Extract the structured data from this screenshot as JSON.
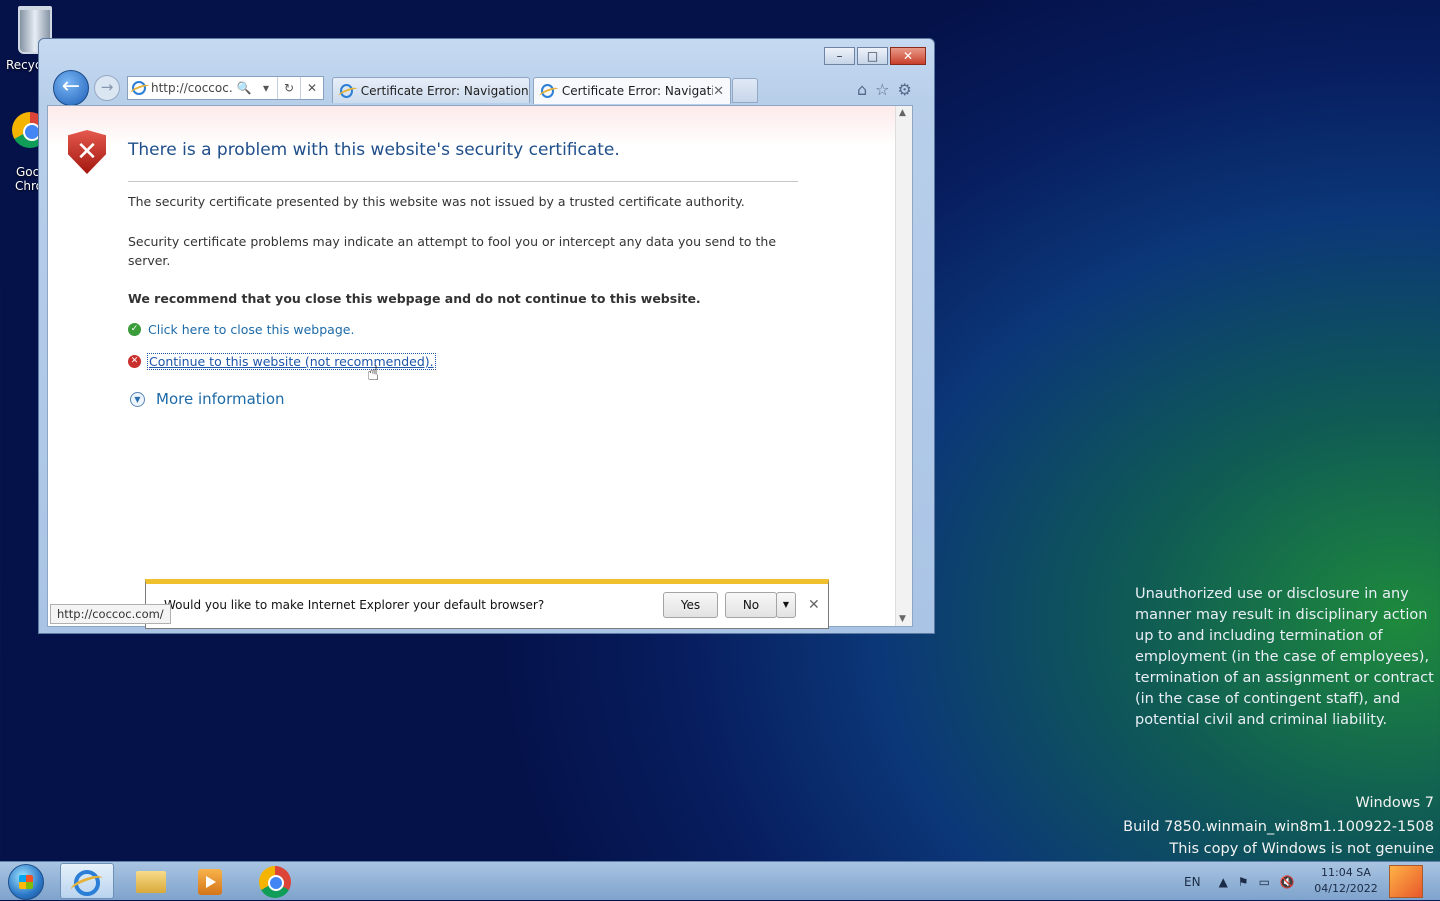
{
  "desktop": {
    "recycle_bin_label": "Recyc",
    "chrome_label_line1": "Goc",
    "chrome_label_line2": "Chro"
  },
  "window": {
    "caption_buttons": {
      "minimize": "–",
      "maximize": "□",
      "close": "✕"
    },
    "address_bar": {
      "url": "http://coccoc....",
      "search_icon": "🔍",
      "dropdown": "▾",
      "refresh": "↻",
      "stop": "✕"
    },
    "tabs": [
      {
        "title": "Certificate Error: Navigation B...",
        "active": false
      },
      {
        "title": "Certificate Error: Navigatio...",
        "active": true,
        "close": "✕"
      }
    ],
    "command_icons": {
      "home": "⌂",
      "favorites": "☆",
      "tools": "⚙"
    }
  },
  "cert_error": {
    "title": "There is a problem with this website's security certificate.",
    "paragraph1": "The security certificate presented by this website was not issued by a trusted certificate authority.",
    "paragraph2": "Security certificate problems may indicate an attempt to fool you or intercept any data you send to the server.",
    "recommendation": "We recommend that you close this webpage and do not continue to this website.",
    "close_link": "Click here to close this webpage.",
    "continue_link": "Continue to this website (not recommended).",
    "more_info": "More information"
  },
  "notification": {
    "message": "Would you like to make Internet Explorer your default browser?",
    "yes": "Yes",
    "no": "No",
    "dropdown": "▼",
    "close": "✕"
  },
  "status_url": "http://coccoc.com/",
  "legal_notice": "Unauthorized use or disclosure in any manner may result in disciplinary action up to and including termination of employment (in the case of employees), termination of an assignment or contract (in the case of contingent staff), and potential civil and criminal liability.",
  "watermark": {
    "line1": "Windows 7",
    "line2": "Build 7850.winmain_win8m1.100922-1508",
    "line3": "This copy of Windows is not genuine"
  },
  "taskbar": {
    "language": "EN",
    "tray_up": "▲",
    "time": "11:04 SA",
    "date": "04/12/2022"
  }
}
